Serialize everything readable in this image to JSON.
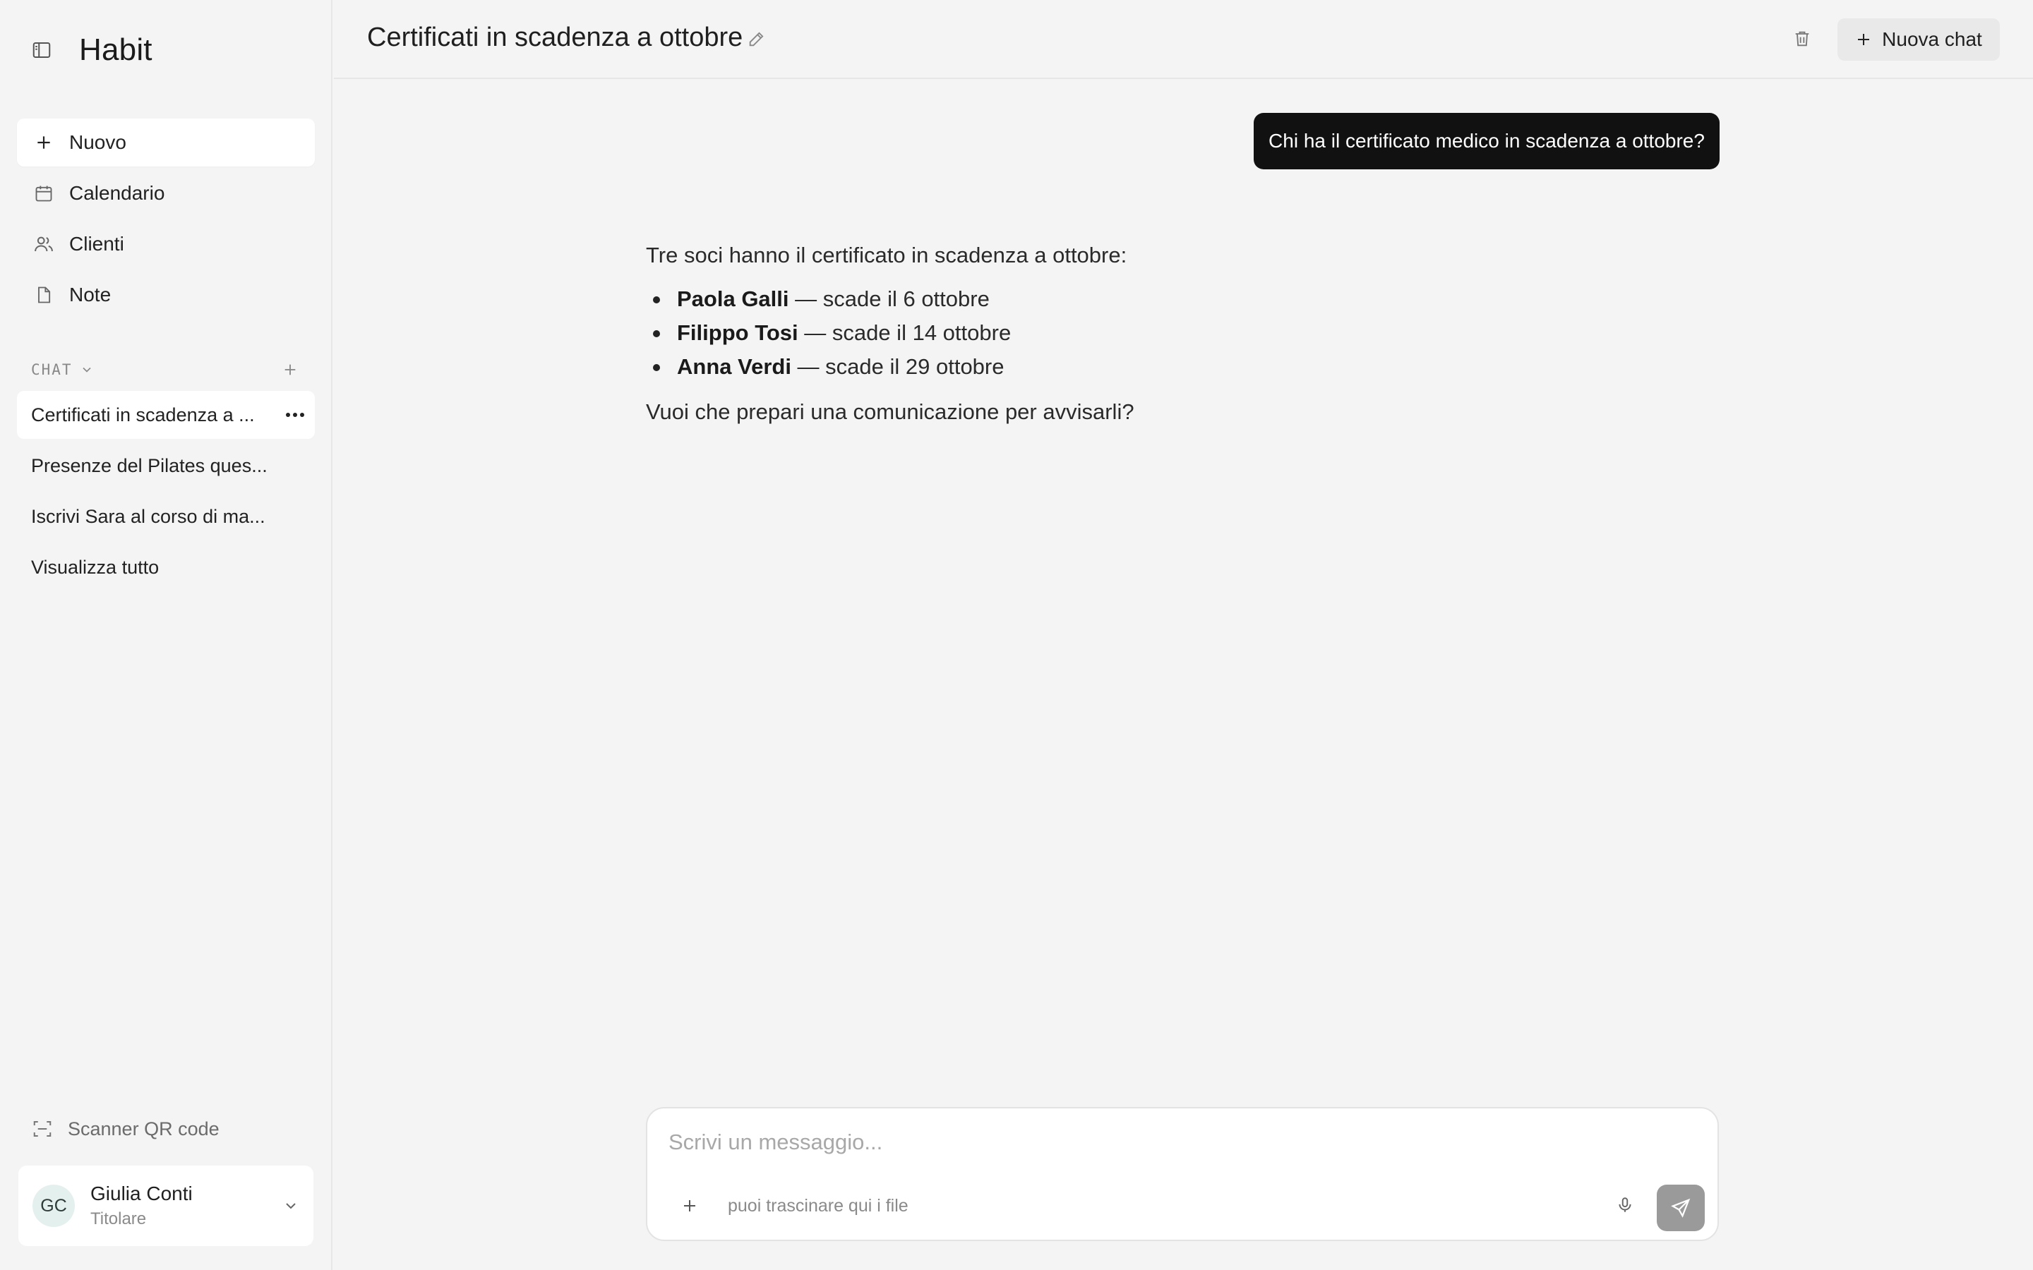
{
  "app": {
    "name": "Habit"
  },
  "sidebar": {
    "toggle_icon": "sidebar-toggle-icon",
    "nav": [
      {
        "label": "Nuovo",
        "icon": "plus-icon",
        "active": true
      },
      {
        "label": "Calendario",
        "icon": "calendar-icon",
        "active": false
      },
      {
        "label": "Clienti",
        "icon": "users-icon",
        "active": false
      },
      {
        "label": "Note",
        "icon": "document-icon",
        "active": false
      }
    ],
    "chat_section_label": "CHAT",
    "chats": [
      {
        "label": "Certificati in scadenza a ...",
        "active": true
      },
      {
        "label": "Presenze del Pilates ques...",
        "active": false
      },
      {
        "label": "Iscrivi Sara al corso di ma...",
        "active": false
      },
      {
        "label": "Visualizza tutto",
        "active": false
      }
    ],
    "scanner_label": "Scanner QR code",
    "user": {
      "initials": "GC",
      "name": "Giulia Conti",
      "role": "Titolare"
    }
  },
  "header": {
    "title": "Certificati in scadenza a ottobre",
    "new_chat_label": "Nuova chat"
  },
  "conversation": {
    "user_message": "Chi ha il certificato medico in scadenza a ottobre?",
    "assistant": {
      "intro": "Tre soci hanno il certificato in scadenza a ottobre:",
      "items": [
        {
          "name": "Paola Galli",
          "detail": " — scade il 6 ottobre"
        },
        {
          "name": "Filippo Tosi",
          "detail": " — scade il 14 ottobre"
        },
        {
          "name": "Anna Verdi",
          "detail": " — scade il 29 ottobre"
        }
      ],
      "outro": "Vuoi che prepari una comunicazione per avvisarli?"
    }
  },
  "composer": {
    "placeholder": "Scrivi un messaggio...",
    "hint": "puoi trascinare qui i file"
  },
  "colors": {
    "background": "#f4f4f4",
    "user_bubble": "#111111",
    "send_button": "#9a9a9a",
    "avatar_bg": "#e3f0ed"
  }
}
